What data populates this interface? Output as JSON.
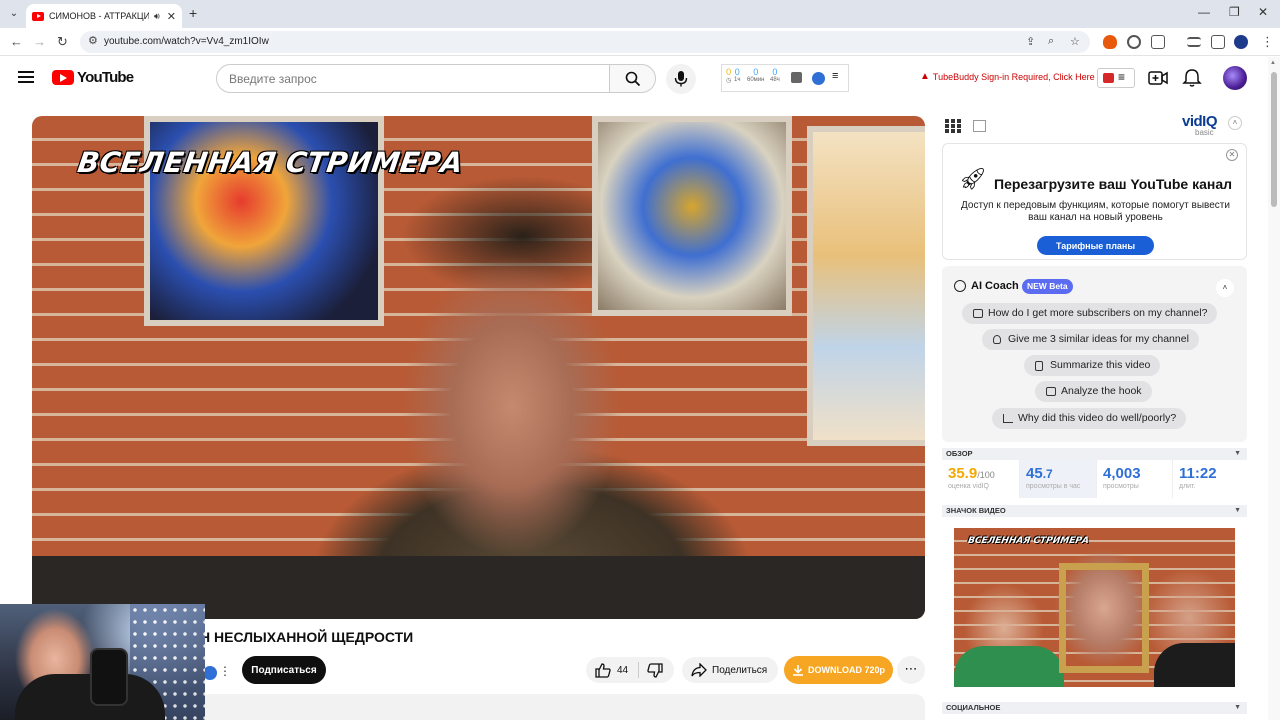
{
  "browser": {
    "tab_title": "СИМОНОВ - АТТРАКЦИОН",
    "url": "youtube.com/watch?v=Vv4_zm1IOIw"
  },
  "youtube": {
    "logo_text": "YouTube",
    "search_placeholder": "Введите запрос"
  },
  "stats_widget": {
    "cols": [
      {
        "value": "0",
        "label": ""
      },
      {
        "value": "0",
        "label": "1ч"
      },
      {
        "value": "0",
        "label": "60мин"
      },
      {
        "value": "0",
        "label": "48ч"
      }
    ]
  },
  "tubebuddy": {
    "warning": "TubeBuddy Sign-in Required, Click Here"
  },
  "video": {
    "overlay_caption": "ВСЕЛЕННАЯ СТРИМЕРА",
    "title": "Н НЕСЛЫХАННОЙ ЩЕДРОСТИ",
    "subscribe_label": "Подписаться",
    "like_count": "44",
    "share_label": "Поделиться",
    "download_label": "DOWNLOAD 720p"
  },
  "vidiq": {
    "logo": "vidIQ",
    "plan": "basic",
    "promo": {
      "title": "Перезагрузите ваш YouTube канал",
      "text": "Доступ к передовым функциям, которые помогут вывести ваш канал на новый уровень",
      "button": "Тарифные планы"
    },
    "coach": {
      "title": "AI Coach",
      "badge": "NEW Beta",
      "prompts": [
        "How do I get more subscribers on my channel?",
        "Give me 3 similar ideas for my channel",
        "Summarize this video",
        "Analyze the hook",
        "Why did this video do well/poorly?"
      ]
    },
    "sections": {
      "overview": "ОБЗОР",
      "thumbnail": "ЗНАЧОК ВИДЕО",
      "social": "СОЦИАЛЬНОЕ"
    },
    "stats": {
      "score": "35.9",
      "score_max": "/100",
      "score_label": "оценка vidIQ",
      "vph_int": "45",
      "vph_dec": ".7",
      "vph_label": "просмотры в час",
      "views": "4,003",
      "views_label": "просмотры",
      "duration": "11:22",
      "duration_label": "длит."
    },
    "thumb_caption": "ВСЕЛЕННАЯ СТРИМЕРА"
  },
  "colors": {
    "youtube_red": "#ff0000",
    "vidiq_blue": "#2f6fd6",
    "download_orange": "#f6a623",
    "coach_badge": "#5b6cf0"
  },
  "icons": [
    "search-icon",
    "mic-icon",
    "bell-icon",
    "create-icon",
    "like-icon",
    "dislike-icon",
    "share-icon",
    "download-icon",
    "rocket-icon"
  ]
}
